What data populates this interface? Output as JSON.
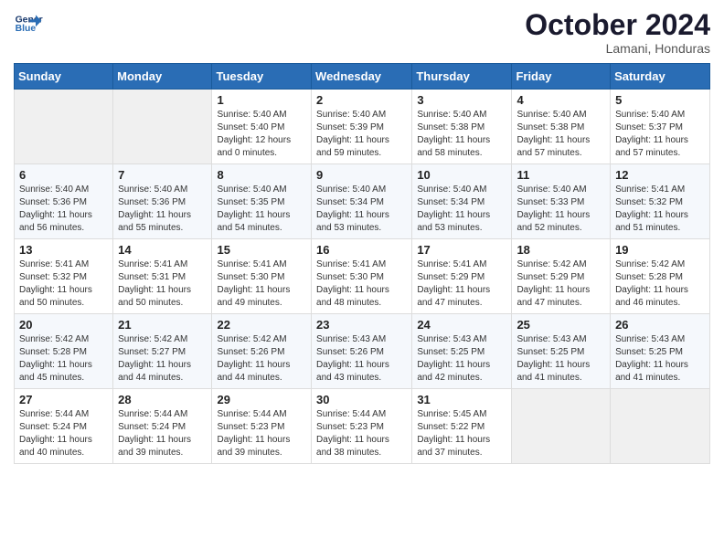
{
  "logo": {
    "line1": "General",
    "line2": "Blue"
  },
  "title": "October 2024",
  "location": "Lamani, Honduras",
  "days_of_week": [
    "Sunday",
    "Monday",
    "Tuesday",
    "Wednesday",
    "Thursday",
    "Friday",
    "Saturday"
  ],
  "weeks": [
    [
      {
        "day": "",
        "info": ""
      },
      {
        "day": "",
        "info": ""
      },
      {
        "day": "1",
        "info": "Sunrise: 5:40 AM\nSunset: 5:40 PM\nDaylight: 12 hours\nand 0 minutes."
      },
      {
        "day": "2",
        "info": "Sunrise: 5:40 AM\nSunset: 5:39 PM\nDaylight: 11 hours\nand 59 minutes."
      },
      {
        "day": "3",
        "info": "Sunrise: 5:40 AM\nSunset: 5:38 PM\nDaylight: 11 hours\nand 58 minutes."
      },
      {
        "day": "4",
        "info": "Sunrise: 5:40 AM\nSunset: 5:38 PM\nDaylight: 11 hours\nand 57 minutes."
      },
      {
        "day": "5",
        "info": "Sunrise: 5:40 AM\nSunset: 5:37 PM\nDaylight: 11 hours\nand 57 minutes."
      }
    ],
    [
      {
        "day": "6",
        "info": "Sunrise: 5:40 AM\nSunset: 5:36 PM\nDaylight: 11 hours\nand 56 minutes."
      },
      {
        "day": "7",
        "info": "Sunrise: 5:40 AM\nSunset: 5:36 PM\nDaylight: 11 hours\nand 55 minutes."
      },
      {
        "day": "8",
        "info": "Sunrise: 5:40 AM\nSunset: 5:35 PM\nDaylight: 11 hours\nand 54 minutes."
      },
      {
        "day": "9",
        "info": "Sunrise: 5:40 AM\nSunset: 5:34 PM\nDaylight: 11 hours\nand 53 minutes."
      },
      {
        "day": "10",
        "info": "Sunrise: 5:40 AM\nSunset: 5:34 PM\nDaylight: 11 hours\nand 53 minutes."
      },
      {
        "day": "11",
        "info": "Sunrise: 5:40 AM\nSunset: 5:33 PM\nDaylight: 11 hours\nand 52 minutes."
      },
      {
        "day": "12",
        "info": "Sunrise: 5:41 AM\nSunset: 5:32 PM\nDaylight: 11 hours\nand 51 minutes."
      }
    ],
    [
      {
        "day": "13",
        "info": "Sunrise: 5:41 AM\nSunset: 5:32 PM\nDaylight: 11 hours\nand 50 minutes."
      },
      {
        "day": "14",
        "info": "Sunrise: 5:41 AM\nSunset: 5:31 PM\nDaylight: 11 hours\nand 50 minutes."
      },
      {
        "day": "15",
        "info": "Sunrise: 5:41 AM\nSunset: 5:30 PM\nDaylight: 11 hours\nand 49 minutes."
      },
      {
        "day": "16",
        "info": "Sunrise: 5:41 AM\nSunset: 5:30 PM\nDaylight: 11 hours\nand 48 minutes."
      },
      {
        "day": "17",
        "info": "Sunrise: 5:41 AM\nSunset: 5:29 PM\nDaylight: 11 hours\nand 47 minutes."
      },
      {
        "day": "18",
        "info": "Sunrise: 5:42 AM\nSunset: 5:29 PM\nDaylight: 11 hours\nand 47 minutes."
      },
      {
        "day": "19",
        "info": "Sunrise: 5:42 AM\nSunset: 5:28 PM\nDaylight: 11 hours\nand 46 minutes."
      }
    ],
    [
      {
        "day": "20",
        "info": "Sunrise: 5:42 AM\nSunset: 5:28 PM\nDaylight: 11 hours\nand 45 minutes."
      },
      {
        "day": "21",
        "info": "Sunrise: 5:42 AM\nSunset: 5:27 PM\nDaylight: 11 hours\nand 44 minutes."
      },
      {
        "day": "22",
        "info": "Sunrise: 5:42 AM\nSunset: 5:26 PM\nDaylight: 11 hours\nand 44 minutes."
      },
      {
        "day": "23",
        "info": "Sunrise: 5:43 AM\nSunset: 5:26 PM\nDaylight: 11 hours\nand 43 minutes."
      },
      {
        "day": "24",
        "info": "Sunrise: 5:43 AM\nSunset: 5:25 PM\nDaylight: 11 hours\nand 42 minutes."
      },
      {
        "day": "25",
        "info": "Sunrise: 5:43 AM\nSunset: 5:25 PM\nDaylight: 11 hours\nand 41 minutes."
      },
      {
        "day": "26",
        "info": "Sunrise: 5:43 AM\nSunset: 5:25 PM\nDaylight: 11 hours\nand 41 minutes."
      }
    ],
    [
      {
        "day": "27",
        "info": "Sunrise: 5:44 AM\nSunset: 5:24 PM\nDaylight: 11 hours\nand 40 minutes."
      },
      {
        "day": "28",
        "info": "Sunrise: 5:44 AM\nSunset: 5:24 PM\nDaylight: 11 hours\nand 39 minutes."
      },
      {
        "day": "29",
        "info": "Sunrise: 5:44 AM\nSunset: 5:23 PM\nDaylight: 11 hours\nand 39 minutes."
      },
      {
        "day": "30",
        "info": "Sunrise: 5:44 AM\nSunset: 5:23 PM\nDaylight: 11 hours\nand 38 minutes."
      },
      {
        "day": "31",
        "info": "Sunrise: 5:45 AM\nSunset: 5:22 PM\nDaylight: 11 hours\nand 37 minutes."
      },
      {
        "day": "",
        "info": ""
      },
      {
        "day": "",
        "info": ""
      }
    ]
  ]
}
